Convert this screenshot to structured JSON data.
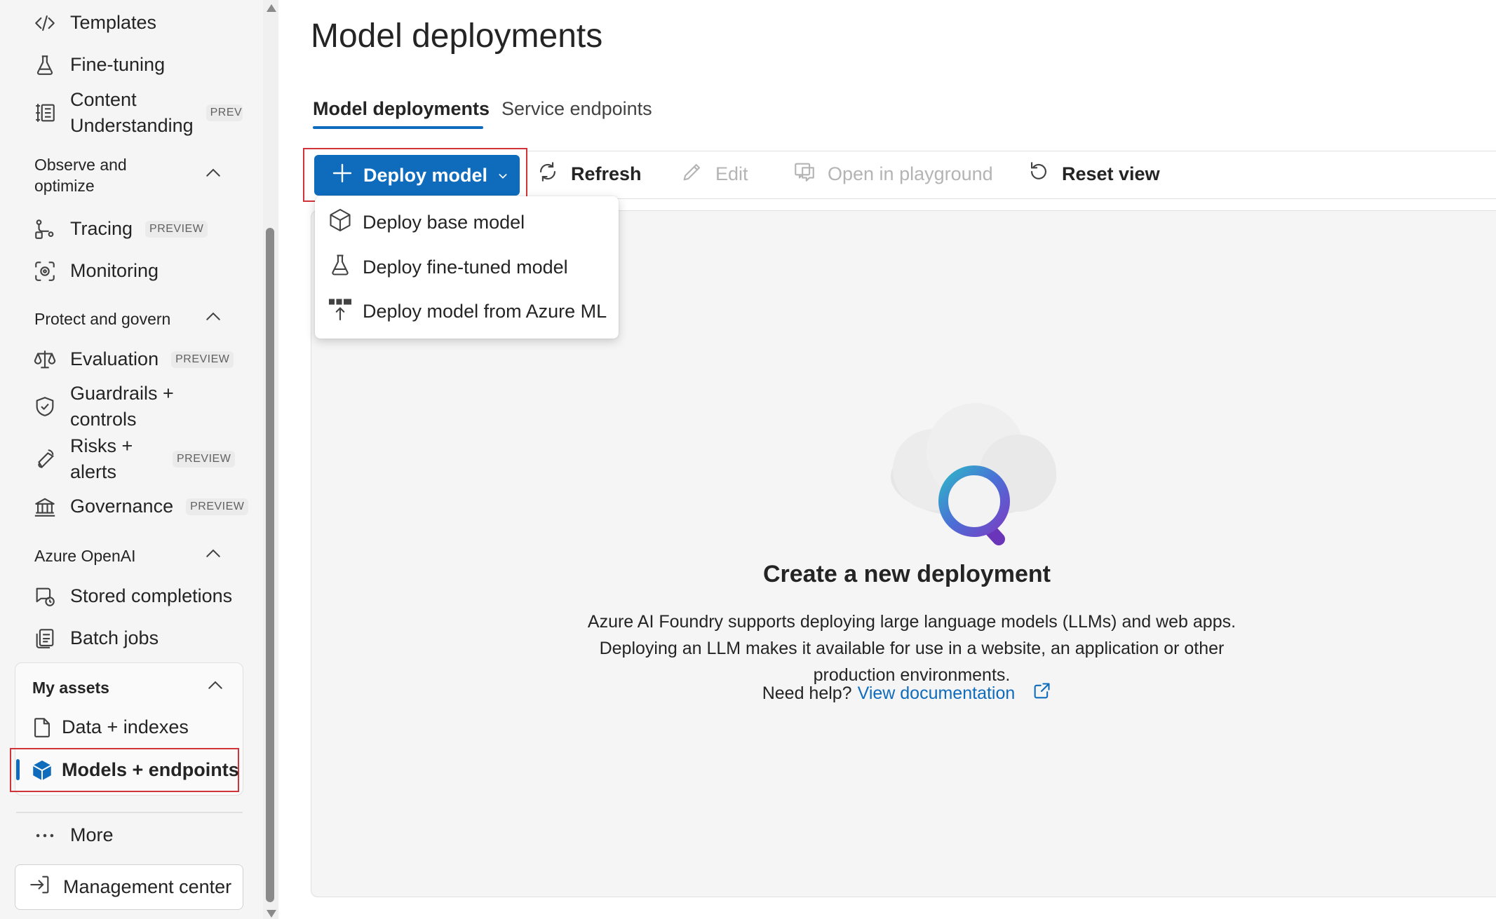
{
  "sidebar": {
    "items": {
      "templates": "Templates",
      "fine_tuning": "Fine-tuning",
      "content_understanding_1": "Content",
      "content_understanding_2": "Understanding",
      "content_understanding_badge": "PREVIEW",
      "tracing": "Tracing",
      "tracing_badge": "PREVIEW",
      "monitoring": "Monitoring",
      "evaluation": "Evaluation",
      "evaluation_badge": "PREVIEW",
      "guardrails_1": "Guardrails +",
      "guardrails_2": "controls",
      "risks_1": "Risks +",
      "risks_2": "alerts",
      "risks_badge": "PREVIEW",
      "governance": "Governance",
      "governance_badge": "PREVIEW",
      "stored_completions": "Stored completions",
      "batch_jobs": "Batch jobs",
      "data_indexes": "Data + indexes",
      "models_endpoints": "Models + endpoints",
      "more": "More",
      "management_center": "Management center"
    },
    "sections": {
      "observe_1": "Observe and",
      "observe_2": "optimize",
      "protect": "Protect and govern",
      "azure_openai": "Azure OpenAI",
      "my_assets": "My assets"
    }
  },
  "main": {
    "title": "Model deployments",
    "tabs": [
      "Model deployments",
      "Service endpoints"
    ],
    "toolbar": {
      "deploy_model": "Deploy model",
      "refresh": "Refresh",
      "edit": "Edit",
      "open_in_playground": "Open in playground",
      "reset_view": "Reset view"
    },
    "deploy_menu": [
      "Deploy base model",
      "Deploy fine-tuned model",
      "Deploy model from Azure ML"
    ],
    "empty_state": {
      "title": "Create a new deployment",
      "description": "Azure AI Foundry supports deploying large language models (LLMs) and web apps. Deploying an LLM makes it available for use in a website, an application or other production environments.",
      "help_prefix": "Need help?",
      "help_link": "View documentation"
    }
  },
  "colors": {
    "accent": "#0f6cbd",
    "highlight_outline": "#d13438",
    "sidebar_bg": "#f5f5f5"
  }
}
